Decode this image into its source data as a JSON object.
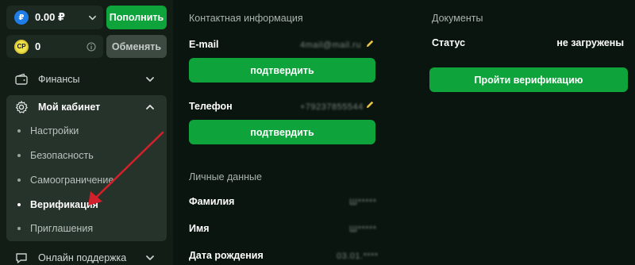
{
  "balance": {
    "currency_icon": "ruble-coin-icon",
    "rub_value": "0.00 ₽",
    "deposit_label": "Пополнить",
    "cp_icon_text": "CP",
    "cp_value": "0",
    "exchange_label": "Обменять"
  },
  "sidebar": {
    "finance_label": "Финансы",
    "cabinet_label": "Мой кабинет",
    "support_label": "Онлайн поддержка",
    "cabinet_items": [
      {
        "label": "Настройки"
      },
      {
        "label": "Безопасность"
      },
      {
        "label": "Самоограничение"
      },
      {
        "label": "Верификация"
      },
      {
        "label": "Приглашения"
      }
    ]
  },
  "contact": {
    "title": "Контактная информация",
    "email_label": "E-mail",
    "email_value": "4mail@mail.ru",
    "confirm_label": "подтвердить",
    "phone_label": "Телефон",
    "phone_value": "+79237855544",
    "confirm_phone_label": "подтвердить"
  },
  "personal": {
    "title": "Личные данные",
    "surname_label": "Фамилия",
    "surname_value": "Ш*****",
    "name_label": "Имя",
    "name_value": "Ш*****",
    "birth_label": "Дата рождения",
    "birth_value": "03.01.****"
  },
  "documents": {
    "title": "Документы",
    "status_label": "Статус",
    "status_value": "не загружены",
    "verify_label": "Пройти верификацию"
  },
  "colors": {
    "accent": "#0ea33b",
    "background": "#0a1510",
    "sidebar": "#121d16",
    "arrow": "#d4202a"
  }
}
